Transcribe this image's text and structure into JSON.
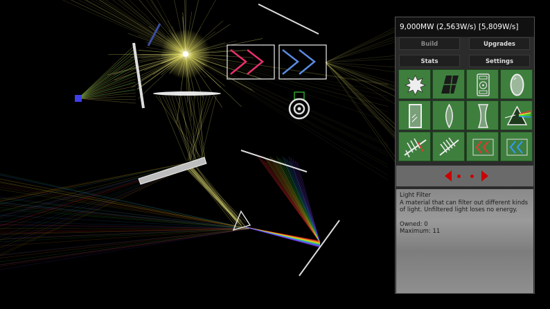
{
  "power_readout": "9,000MW (2,563W/s) [5,809W/s]",
  "menu": {
    "build": "Build",
    "upgrades": "Upgrades",
    "stats": "Stats",
    "settings": "Settings"
  },
  "palette": {
    "tile_bg": "#3e7f3e",
    "pager_arrow": "#cc0000",
    "panel_bg": "#2b2b2b"
  },
  "build_items": [
    {
      "icon": "burst-icon"
    },
    {
      "icon": "solar-panel-icon"
    },
    {
      "icon": "nuclear-reactor-icon"
    },
    {
      "icon": "mirror-icon"
    },
    {
      "icon": "glass-pane-icon"
    },
    {
      "icon": "convex-lens-icon"
    },
    {
      "icon": "concave-lens-icon"
    },
    {
      "icon": "prism-icon"
    },
    {
      "icon": "broken-filter-icon"
    },
    {
      "icon": "diffraction-grating-icon"
    },
    {
      "icon": "red-filter-icon"
    },
    {
      "icon": "blue-filter-icon"
    }
  ],
  "pager": {
    "current_page": 1,
    "total_pages": 2
  },
  "selected_item": {
    "name": "Light Filter",
    "description": "A material that can filter out different kinds of light. Unfiltered light loses no energy.",
    "owned": "Owned: 0",
    "maximum": "Maximum: 11"
  }
}
